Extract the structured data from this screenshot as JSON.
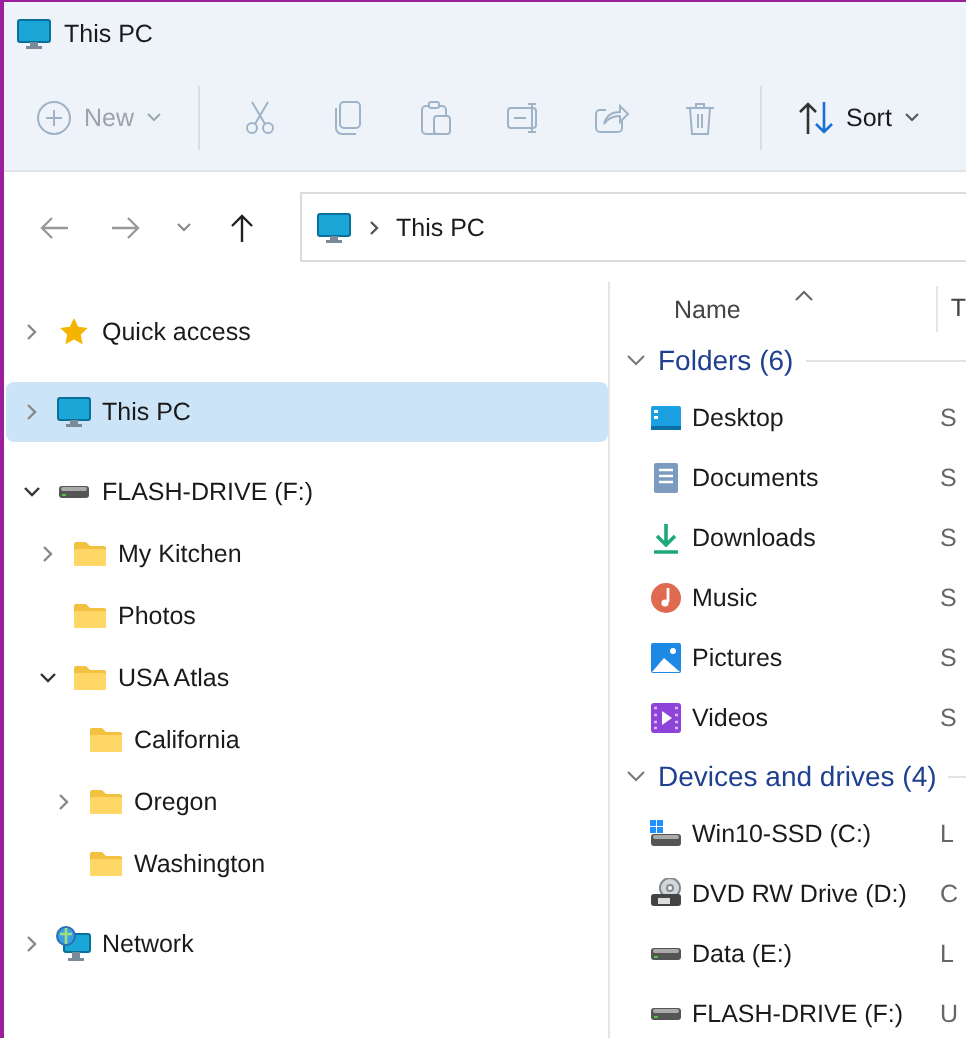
{
  "window": {
    "title": "This PC"
  },
  "toolbar": [
    {
      "kind": "new",
      "label": "New",
      "disabled": true
    },
    {
      "kind": "cut",
      "disabled": true
    },
    {
      "kind": "copy",
      "disabled": true
    },
    {
      "kind": "paste",
      "disabled": true
    },
    {
      "kind": "rename",
      "disabled": true
    },
    {
      "kind": "share",
      "disabled": true
    },
    {
      "kind": "delete",
      "disabled": true
    },
    {
      "kind": "sort",
      "label": "Sort",
      "disabled": false
    }
  ],
  "navigation": {
    "back_disabled": true,
    "forward_disabled": true,
    "up_disabled": false
  },
  "address": {
    "crumbs": [
      "This PC"
    ]
  },
  "sidebar": {
    "items": [
      {
        "label": "Quick access",
        "kind": "star",
        "expandable": true,
        "expanded": false,
        "selected": false
      },
      {
        "label": "This PC",
        "kind": "pc",
        "expandable": true,
        "expanded": false,
        "selected": true
      },
      {
        "label": "FLASH-DRIVE (F:)",
        "kind": "drive",
        "expandable": true,
        "expanded": true,
        "selected": false,
        "children": [
          {
            "label": "My Kitchen",
            "kind": "folder",
            "expandable": true,
            "expanded": false,
            "selected": false
          },
          {
            "label": "Photos",
            "kind": "folder",
            "expandable": false,
            "expanded": false,
            "selected": false
          },
          {
            "label": "USA Atlas",
            "kind": "folder",
            "expandable": true,
            "expanded": true,
            "selected": false,
            "children": [
              {
                "label": "California",
                "kind": "folder",
                "expandable": false,
                "expanded": false,
                "selected": false
              },
              {
                "label": "Oregon",
                "kind": "folder",
                "expandable": true,
                "expanded": false,
                "selected": false
              },
              {
                "label": "Washington",
                "kind": "folder",
                "expandable": false,
                "expanded": false,
                "selected": false
              }
            ]
          }
        ]
      },
      {
        "label": "Network",
        "kind": "network",
        "expandable": true,
        "expanded": false,
        "selected": false
      }
    ]
  },
  "content": {
    "columns": [
      "Name",
      "T"
    ],
    "name_sorted": true,
    "groups": [
      {
        "title": "Folders (6)",
        "expanded": true,
        "items": [
          {
            "name": "Desktop",
            "kind": "desktop",
            "type": "S"
          },
          {
            "name": "Documents",
            "kind": "documents",
            "type": "S"
          },
          {
            "name": "Downloads",
            "kind": "downloads",
            "type": "S"
          },
          {
            "name": "Music",
            "kind": "music",
            "type": "S"
          },
          {
            "name": "Pictures",
            "kind": "pictures",
            "type": "S"
          },
          {
            "name": "Videos",
            "kind": "videos",
            "type": "S"
          }
        ]
      },
      {
        "title": "Devices and drives (4)",
        "expanded": true,
        "items": [
          {
            "name": "Win10-SSD (C:)",
            "kind": "system-drive",
            "type": "L"
          },
          {
            "name": "DVD RW Drive (D:)",
            "kind": "dvd",
            "type": "C"
          },
          {
            "name": "Data (E:)",
            "kind": "drive",
            "type": "L"
          },
          {
            "name": "FLASH-DRIVE (F:)",
            "kind": "drive",
            "type": "U"
          }
        ]
      }
    ]
  }
}
